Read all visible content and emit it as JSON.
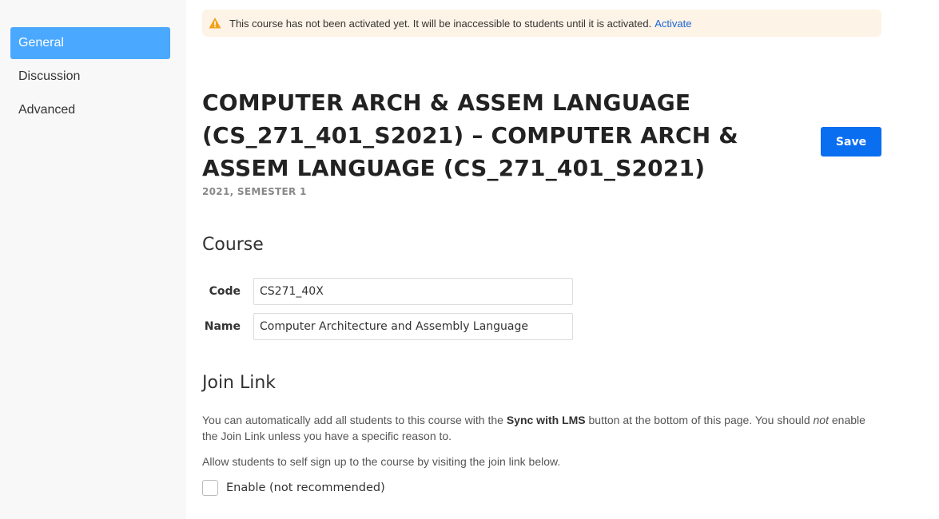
{
  "sidebar": {
    "items": [
      {
        "label": "General"
      },
      {
        "label": "Discussion"
      },
      {
        "label": "Advanced"
      }
    ]
  },
  "banner": {
    "message": "This course has not been activated yet. It will be inaccessible to students until it is activated.",
    "action": "Activate"
  },
  "header": {
    "title": "COMPUTER ARCH & ASSEM LANGUAGE (CS_271_401_S2021) – COMPUTER ARCH & ASSEM LANGUAGE (CS_271_401_S2021)",
    "subtitle": "2021, SEMESTER 1",
    "save_label": "Save"
  },
  "course_section": {
    "heading": "Course",
    "code_label": "Code",
    "code_value": "CS271_40X",
    "name_label": "Name",
    "name_value": "Computer Architecture and Assembly Language"
  },
  "join_link": {
    "heading": "Join Link",
    "desc1_pre": "You can automatically add all students to this course with the ",
    "desc1_bold": "Sync with LMS",
    "desc1_mid": " button at the bottom of this page. You should ",
    "desc1_em": "not",
    "desc1_post": " enable the Join Link unless you have a specific reason to.",
    "desc2": "Allow students to self sign up to the course by visiting the join link below.",
    "checkbox_label": "Enable (not recommended)"
  },
  "colors": {
    "accent": "#4aa8ff",
    "primary_button": "#0a6ef0",
    "warning_bg": "#fdf3e6",
    "warning_icon": "#f0a21a",
    "link": "#1a66d6"
  }
}
